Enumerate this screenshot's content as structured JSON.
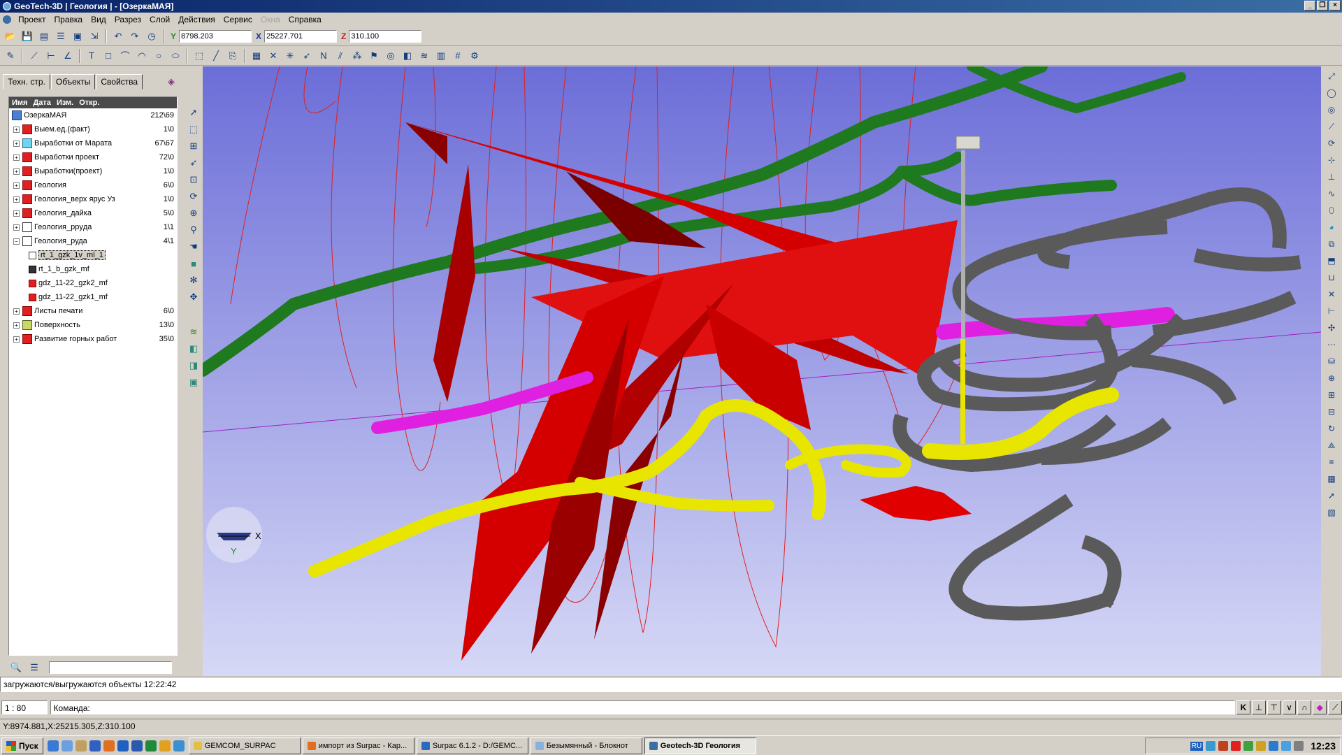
{
  "window": {
    "title": "GeoTech-3D | Геология | - [ОзеркаМАЯ]"
  },
  "menu": [
    "Проект",
    "Правка",
    "Вид",
    "Разрез",
    "Слой",
    "Действия",
    "Сервис",
    "Окна",
    "Справка"
  ],
  "menu_disabled": [
    "Окна"
  ],
  "coords": {
    "y_label": "Y",
    "y_value": "8798.203",
    "x_label": "X",
    "x_value": "25227.701",
    "z_label": "Z",
    "z_value": "310.100"
  },
  "panel": {
    "tabs": [
      "Техн. стр.",
      "Объекты",
      "Свойства"
    ],
    "active_tab": "Объекты",
    "columns": [
      "Имя",
      "Дата",
      "Изм.",
      "Откр."
    ],
    "root": {
      "label": "ОзеркаМАЯ",
      "count": "212\\69"
    },
    "items": [
      {
        "label": "Выем.ед.(факт)",
        "count": "1\\0",
        "icon": "red"
      },
      {
        "label": "Выработки от Марата",
        "count": "67\\67",
        "icon": "sky"
      },
      {
        "label": "Выработки проект",
        "count": "72\\0",
        "icon": "red"
      },
      {
        "label": "Выработки(проект)",
        "count": "1\\0",
        "icon": "red"
      },
      {
        "label": "Геология",
        "count": "6\\0",
        "icon": "red"
      },
      {
        "label": "Геология_верх ярус Уз",
        "count": "1\\0",
        "icon": "red"
      },
      {
        "label": "Геология_дайка",
        "count": "5\\0",
        "icon": "red"
      },
      {
        "label": "Геология_ррyда",
        "count": "1\\1",
        "icon": "geo"
      },
      {
        "label": "Геология_руда",
        "count": "4\\1",
        "icon": "geo"
      }
    ],
    "children": [
      "rt_1_gzk_1v_ml_1",
      "rt_1_b_gzk_mf",
      "gdz_11-22_gzk2_mf",
      "gdz_11-22_gzk1_mf"
    ],
    "items_after": [
      {
        "label": "Листы печати",
        "count": "6\\0",
        "icon": "red"
      },
      {
        "label": "Поверхность",
        "count": "13\\0",
        "icon": "surf"
      },
      {
        "label": "Развитие горных работ",
        "count": "35\\0",
        "icon": "red"
      }
    ]
  },
  "viewport": {
    "axis_x": "X",
    "axis_y": "Y"
  },
  "message": "загружаются/выгружаются объекты 12:22:42",
  "scale": "1 : 80",
  "command_label": "Команда:",
  "status": "Y:8974.881,X:25215.305,Z:310.100",
  "taskbar": {
    "start": "Пуск",
    "tasks": [
      "GEMCOM_SURPAC",
      "импорт из Surpac - Кар...",
      "Surpac 6.1.2 - D:/GEMC...",
      "Безымянный - Блокнот",
      "Geotech-3D Геология"
    ],
    "active_task": "Geotech-3D Геология",
    "lang": "RU",
    "clock": "12:23"
  },
  "colors": {
    "viewport_top": "#6c6ed8",
    "viewport_bottom": "#d6d8f6",
    "ore": "#d40000",
    "green_workings": "#1f7a1f",
    "yellow_workings": "#e8e600",
    "magenta_workings": "#e020e0",
    "gray_ramp": "#5a5a5a"
  }
}
